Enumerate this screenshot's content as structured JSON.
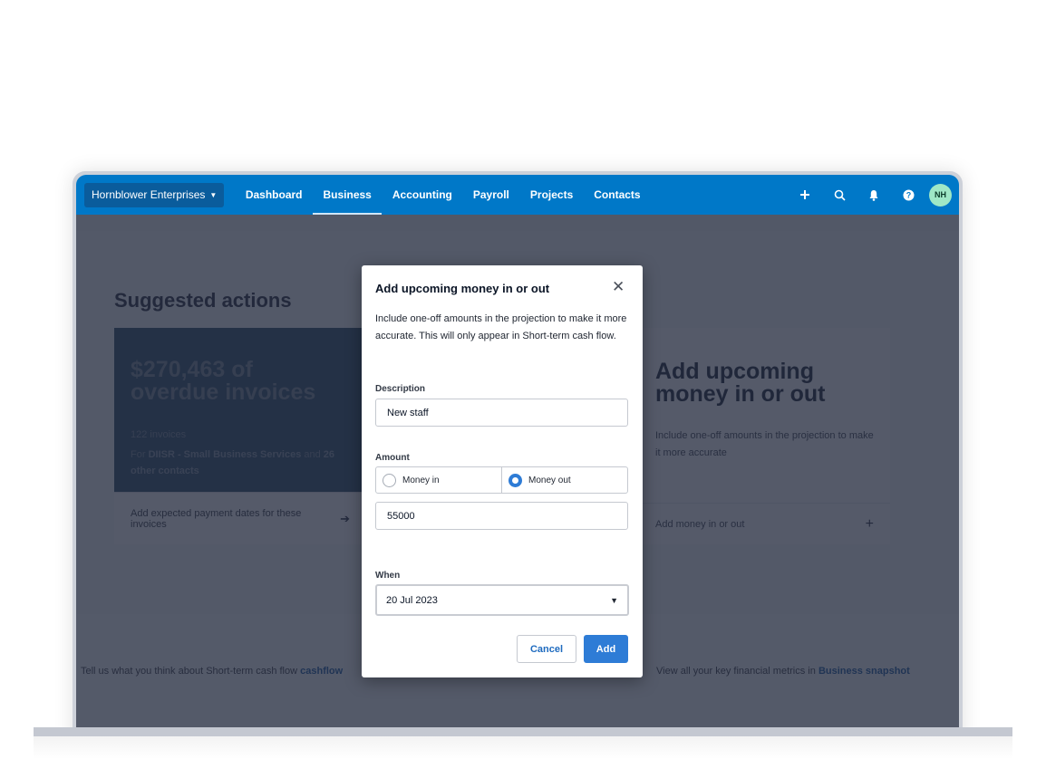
{
  "topnav": {
    "org": "Hornblower Enterprises",
    "items": [
      {
        "label": "Dashboard",
        "active": false
      },
      {
        "label": "Business",
        "active": true
      },
      {
        "label": "Accounting",
        "active": false
      },
      {
        "label": "Payroll",
        "active": false
      },
      {
        "label": "Projects",
        "active": false
      },
      {
        "label": "Contacts",
        "active": false
      }
    ],
    "icons": [
      "plus-icon",
      "search-icon",
      "bell-icon",
      "help-icon"
    ],
    "avatar_initials": "NH",
    "brand_color": "#0078c8"
  },
  "page": {
    "section_title": "Suggested actions",
    "overdue_card": {
      "headline_line1": "$270,463 of",
      "headline_line2": "overdue invoices",
      "count": "122 invoices",
      "for_prefix": "For",
      "contact": "DIISR - Small Business Services",
      "and": "and",
      "others": "26 other contacts",
      "action": "Add expected payment dates for these invoices"
    },
    "upcoming_card": {
      "headline_line1": "Add upcoming",
      "headline_line2": "money in or out",
      "description": "Include one-off amounts in the projection to make it more accurate",
      "action": "Add money in or out"
    },
    "feedback_text": "Tell us what you think about Short-term cash flow",
    "feedback_link": "cashflow",
    "snapshot_text": "View all your key financial metrics in",
    "snapshot_link": "Business snapshot"
  },
  "modal": {
    "title": "Add upcoming money in or out",
    "description": "Include one-off amounts in the projection to make it more accurate. This will only appear in Short-term cash flow.",
    "description_label": "Description",
    "description_value": "New staff",
    "amount_label": "Amount",
    "radio_options": [
      {
        "label": "Money in",
        "checked": false
      },
      {
        "label": "Money out",
        "checked": true
      }
    ],
    "amount_value": "55000",
    "when_label": "When",
    "when_value": "20 Jul 2023",
    "cancel_label": "Cancel",
    "add_label": "Add",
    "accent_color": "#2e7cd6"
  }
}
